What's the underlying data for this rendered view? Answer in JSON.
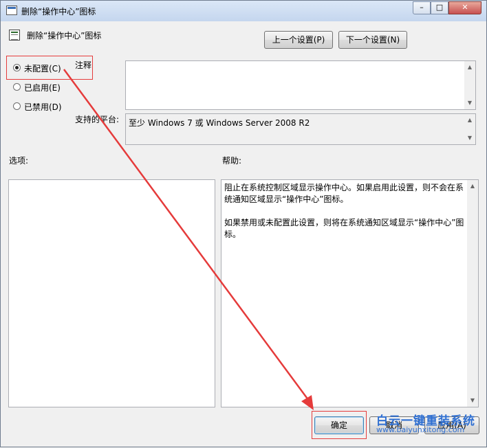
{
  "window": {
    "title": "删除“操作中心”图标",
    "controls": {
      "minimize": "–",
      "maximize": "□",
      "close": "✕"
    }
  },
  "header": {
    "title": "删除“操作中心”图标"
  },
  "nav": {
    "prev_label": "上一个设置(P)",
    "next_label": "下一个设置(N)"
  },
  "radios": [
    {
      "label": "未配置(C)",
      "selected": true
    },
    {
      "label": "已启用(E)",
      "selected": false
    },
    {
      "label": "已禁用(D)",
      "selected": false
    }
  ],
  "comment": {
    "label": "注释",
    "value": ""
  },
  "platform": {
    "label": "支持的平台:",
    "value": "至少 Windows 7 或 Windows Server 2008 R2"
  },
  "options": {
    "label": "选项:"
  },
  "help": {
    "label": "帮助:",
    "paragraphs": [
      "阻止在系统控制区域显示操作中心。如果启用此设置，则不会在系统通知区域显示“操作中心”图标。",
      "如果禁用或未配置此设置，则将在系统通知区域显示“操作中心”图标。"
    ]
  },
  "buttons": {
    "ok": "确定",
    "cancel": "取消",
    "apply": "应用(A)"
  },
  "watermark": {
    "brand": "白云一键重装系统",
    "url": "www.baiyunxitong.com"
  },
  "colors": {
    "annotation": "#e53b3b",
    "watermark": "#2f6fd1",
    "titlebar": "#c4d6ee"
  },
  "icons": {
    "title": "policy-icon",
    "header": "policy-icon"
  }
}
